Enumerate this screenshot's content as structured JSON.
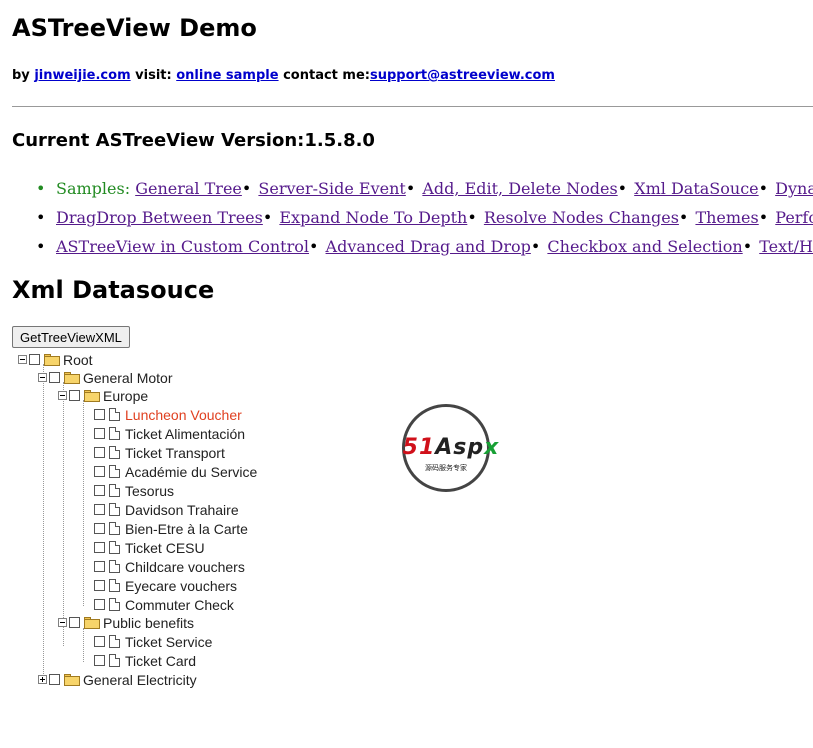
{
  "header": {
    "title": "ASTreeView Demo",
    "by_text": "by ",
    "author_link": "jinweijie.com",
    "visit_text": " visit: ",
    "sample_link": "online sample",
    "contact_text": " contact me:",
    "email_link": "support@astreeview.com"
  },
  "version_heading": "Current ASTreeView Version:1.5.8.0",
  "nav": {
    "samples_label": "Samples:",
    "row1": [
      "General Tree",
      "Server-Side Event",
      "Add, Edit, Delete Nodes",
      "Xml DataSouce",
      "Dynamic Loading"
    ],
    "row2": [
      "DragDrop Between Trees",
      "Expand Node To Depth",
      "Resolve Nodes Changes",
      "Themes",
      "Performance Test"
    ],
    "row3": [
      "ASTreeView in Custom Control",
      "Advanced Drag and Drop",
      "Checkbox and Selection",
      "Text/Html Node"
    ]
  },
  "section_heading": "Xml Datasouce",
  "button_label": "GetTreeViewXML",
  "tree": {
    "root": "Root",
    "general_motor": "General Motor",
    "europe": "Europe",
    "europe_items": [
      "Luncheon Voucher",
      "Ticket Alimentación",
      "Ticket Transport",
      "Académie du Service",
      "Tesorus",
      "Davidson Trahaire",
      "Bien-Etre à la Carte",
      "Ticket CESU",
      "Childcare vouchers",
      "Eyecare vouchers",
      "Commuter Check"
    ],
    "public_benefits": "Public benefits",
    "public_items": [
      "Ticket Service",
      "Ticket Card"
    ],
    "general_electricity": "General Electricity",
    "selected_color": "#e04020"
  },
  "watermark": {
    "logo_a": "51",
    "logo_b": "Asp",
    "logo_c": "x",
    "sub": "源码服务专家"
  }
}
